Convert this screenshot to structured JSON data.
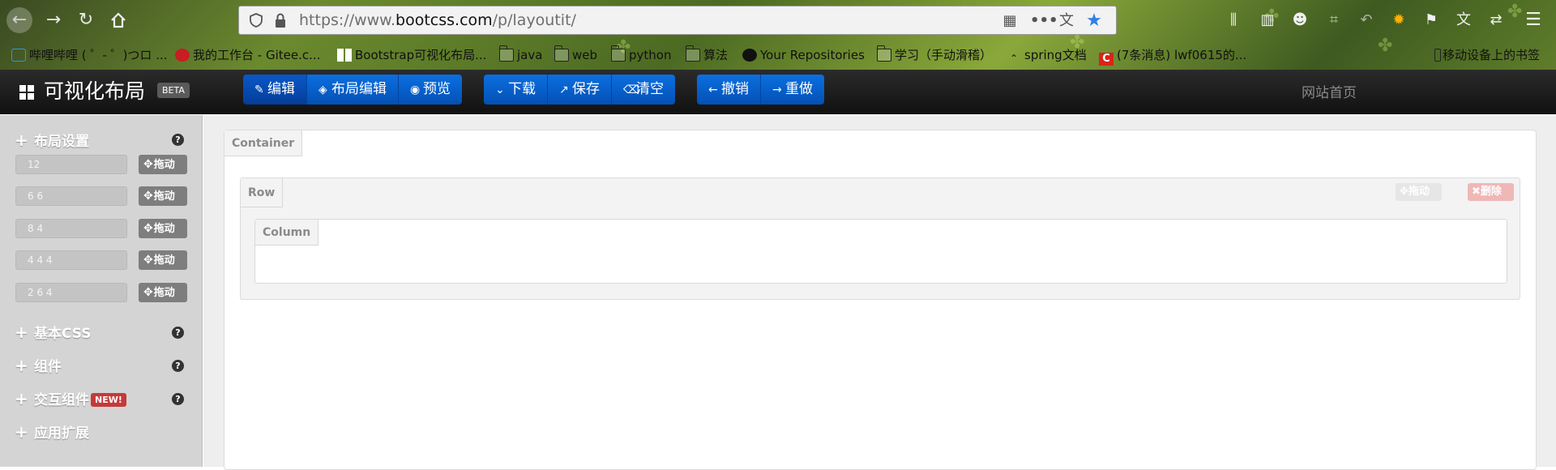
{
  "browser": {
    "url_prefix": "https://www.",
    "url_domain": "bootcss.com",
    "url_path": "/p/layoutit/",
    "bookmarks": [
      {
        "label": "哔哩哔哩 ( ゜- ゜)つロ ..."
      },
      {
        "label": "我的工作台 - Gitee.c..."
      },
      {
        "label": "Bootstrap可视化布局..."
      },
      {
        "label": "java"
      },
      {
        "label": "web"
      },
      {
        "label": "python"
      },
      {
        "label": "算法"
      },
      {
        "label": "Your Repositories"
      },
      {
        "label": "学习（手动滑稽）"
      },
      {
        "label": "spring文档"
      },
      {
        "label": "(7条消息) lwf0615的..."
      },
      {
        "label": "移动设备上的书签"
      }
    ]
  },
  "app": {
    "brand": "可视化布局",
    "beta": "BETA",
    "group1": [
      "编辑",
      "布局编辑",
      "预览"
    ],
    "group2": [
      "下载",
      "保存",
      "清空"
    ],
    "group3": [
      "撤销",
      "重做"
    ],
    "home": "网站首页"
  },
  "sidebar": {
    "layout_title": "布局设置",
    "grid_rows": [
      "12",
      "6 6",
      "8 4",
      "4 4 4",
      "2 6 4"
    ],
    "drag_label": "拖动",
    "sections": [
      {
        "label": "基本CSS"
      },
      {
        "label": "组件"
      },
      {
        "label": "交互组件",
        "badge": "NEW!"
      },
      {
        "label": "应用扩展"
      }
    ],
    "help": "?"
  },
  "canvas": {
    "container_label": "Container",
    "row_label": "Row",
    "column_label": "Column",
    "row_drag": "拖动",
    "row_delete": "删除"
  }
}
